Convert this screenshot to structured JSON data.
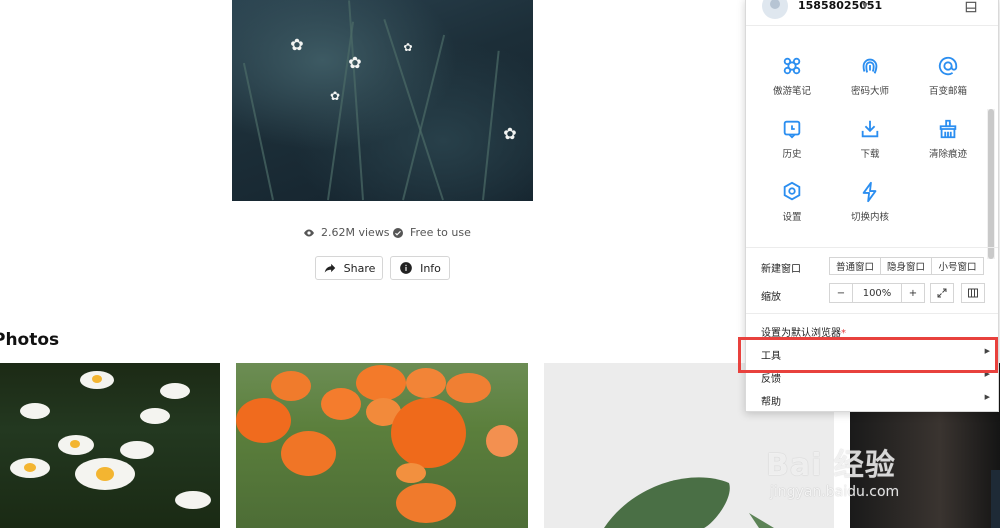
{
  "page": {
    "stats": {
      "views": "2.62M views",
      "license": "Free to use"
    },
    "buttons": {
      "share": "Share",
      "info": "Info"
    },
    "section_title": "Photos"
  },
  "watermark": {
    "brand": "Bai  经验",
    "url": "jingyan.baidu.com"
  },
  "menu": {
    "username": "15858025051",
    "grid": [
      {
        "label": "傲游笔记",
        "icon": "notes-icon"
      },
      {
        "label": "密码大师",
        "icon": "fingerprint-icon"
      },
      {
        "label": "百变邮箱",
        "icon": "mail-at-icon"
      },
      {
        "label": "历史",
        "icon": "history-icon"
      },
      {
        "label": "下载",
        "icon": "download-icon"
      },
      {
        "label": "清除痕迹",
        "icon": "broom-icon"
      },
      {
        "label": "设置",
        "icon": "gear-icon"
      },
      {
        "label": "切换内核",
        "icon": "lightning-icon"
      }
    ],
    "new_window": {
      "label": "新建窗口",
      "options": [
        "普通窗口",
        "隐身窗口",
        "小号窗口"
      ]
    },
    "zoom": {
      "label": "缩放",
      "minus": "−",
      "value": "100%",
      "plus": "+"
    },
    "default_browser": "设置为默认浏览器",
    "default_browser_mark": "*",
    "items": [
      {
        "label": "工具",
        "arrow": "▶"
      },
      {
        "label": "反馈",
        "arrow": "▶"
      },
      {
        "label": "帮助",
        "arrow": "▶"
      }
    ],
    "accent": "#2b8ef0",
    "highlight_color": "#e8413d"
  }
}
